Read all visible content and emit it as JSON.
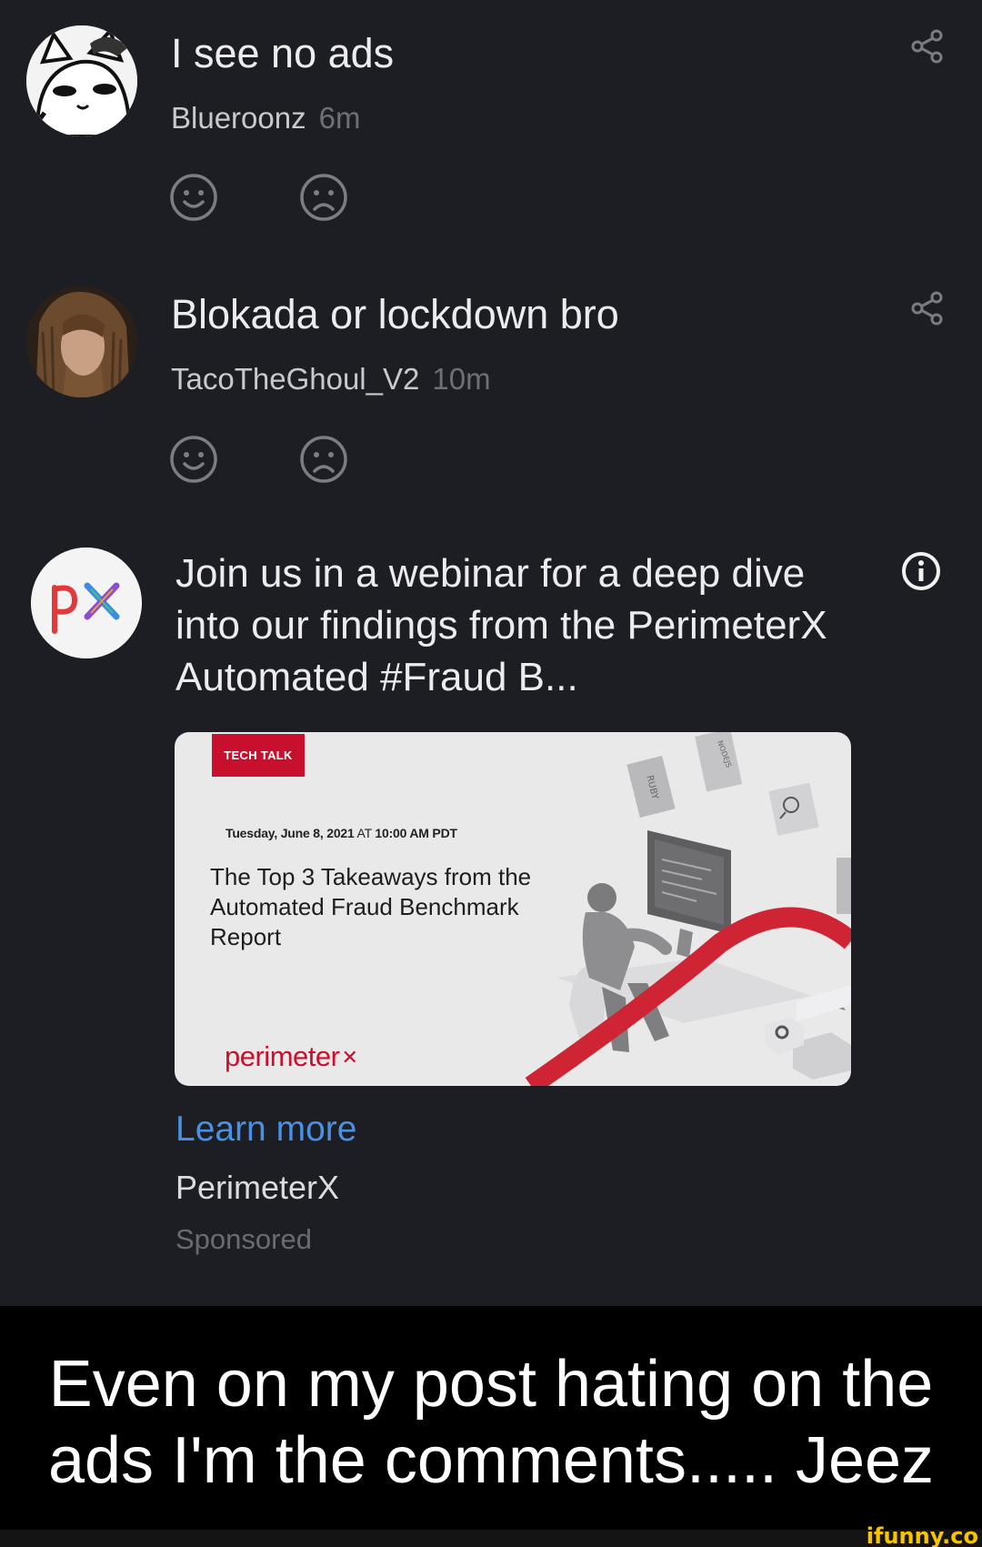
{
  "comments": [
    {
      "text": "I see no ads",
      "user": "Blueroonz",
      "time": "6m",
      "share_icon": "share-icon",
      "reactions": [
        "smile-icon",
        "frown-icon"
      ]
    },
    {
      "text": "Blokada or lockdown bro",
      "user": "TacoTheGhoul_V2",
      "time": "10m",
      "share_icon": "share-icon",
      "reactions": [
        "smile-icon",
        "frown-icon"
      ]
    }
  ],
  "ad": {
    "text": "Join us in a webinar for a deep dive into our findings from the PerimeterX Automated #Fraud B...",
    "badge": "TECH TALK",
    "date_bold_1": "Tuesday, June 8, 2021",
    "date_at": " AT ",
    "date_bold_2": "10:00 AM PDT",
    "banner_title": "The Top 3 Takeaways from the Automated Fraud Benchmark Report",
    "logo_text": "perimeter",
    "logo_mark": "✕",
    "art_label_1": "RUBY",
    "art_label_2": "NODEJS",
    "learn_more": "Learn more",
    "advertiser": "PerimeterX",
    "sponsored": "Sponsored",
    "info_icon": "info-icon"
  },
  "caption": "Even on my post hating on the ads I'm the comments..... Jeez",
  "watermark": "ifunny.co",
  "colors": {
    "background": "#1d1e24",
    "link": "#4a90e2",
    "brand_red": "#c8102e"
  }
}
